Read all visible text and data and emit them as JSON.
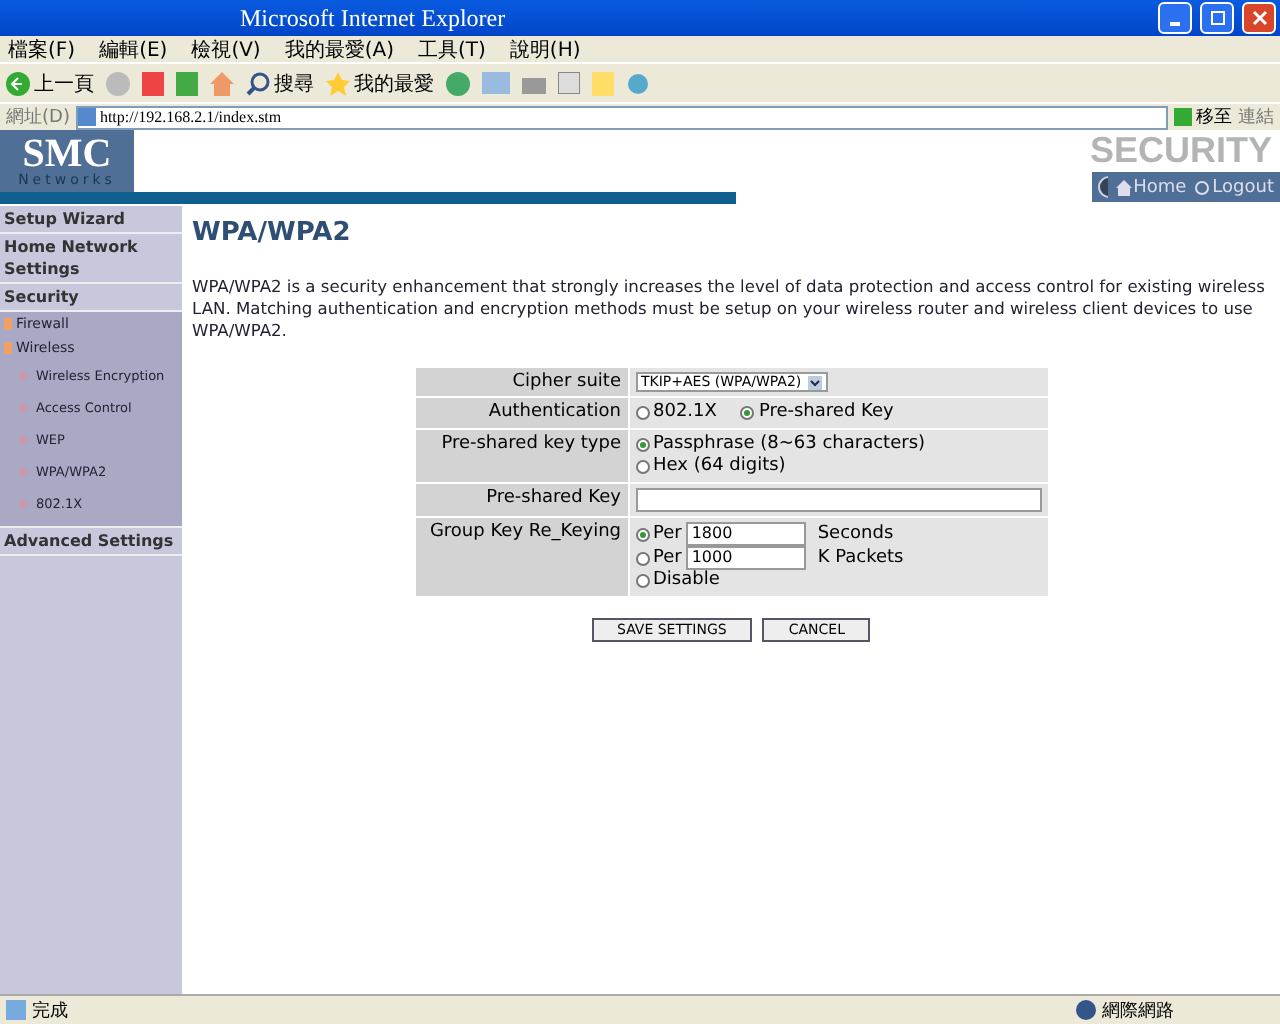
{
  "window": {
    "title": "Microsoft Internet Explorer"
  },
  "menu": [
    "檔案(F)",
    "編輯(E)",
    "檢視(V)",
    "我的最愛(A)",
    "工具(T)",
    "說明(H)"
  ],
  "toolbar": {
    "back": "上一頁",
    "search": "搜尋",
    "favorites": "我的最愛"
  },
  "address": {
    "label": "網址(D)",
    "value": "http://192.168.2.1/index.stm",
    "go": "移至",
    "links": "連結"
  },
  "header": {
    "logo": "SMC",
    "logo_sub": "Networks",
    "section": "SECURITY",
    "home": "Home",
    "logout": "Logout"
  },
  "sidebar": {
    "items": [
      {
        "label": "Setup Wizard",
        "kind": "top"
      },
      {
        "label": "Home Network Settings",
        "kind": "top"
      },
      {
        "label": "Security",
        "kind": "top",
        "children": [
          {
            "label": "Firewall",
            "kind": "sub"
          },
          {
            "label": "Wireless",
            "kind": "sub"
          },
          {
            "label": "Wireless Encryption",
            "kind": "leaf"
          },
          {
            "label": "Access Control",
            "kind": "leaf"
          },
          {
            "label": "WEP",
            "kind": "leaf"
          },
          {
            "label": "WPA/WPA2",
            "kind": "leaf"
          },
          {
            "label": "802.1X",
            "kind": "leaf"
          }
        ]
      },
      {
        "label": "Advanced Settings",
        "kind": "top"
      }
    ]
  },
  "page": {
    "title": "WPA/WPA2",
    "description": "WPA/WPA2 is a security enhancement that strongly increases the level of data protection and access control for existing wireless LAN. Matching authentication and encryption methods must be setup on your wireless router and wireless client devices to use WPA/WPA2."
  },
  "form": [
    {
      "label": "Cipher suite",
      "kind": "select",
      "value": "TKIP+AES (WPA/WPA2)"
    },
    {
      "label": "Authentication",
      "kind": "radio-inline",
      "options": [
        {
          "label": "802.1X",
          "selected": false
        },
        {
          "label": "Pre-shared Key",
          "selected": true
        }
      ]
    },
    {
      "label": "Pre-shared key type",
      "kind": "radio",
      "options": [
        {
          "label": "Passphrase (8~63 characters)",
          "selected": true
        },
        {
          "label": "Hex (64 digits)",
          "selected": false
        }
      ]
    },
    {
      "label": "Pre-shared Key",
      "kind": "text"
    },
    {
      "label": "Group Key Re_Keying",
      "kind": "radio",
      "options": [
        {
          "label": "Per",
          "value": "1800",
          "unit": "Seconds",
          "selected": true
        },
        {
          "label": "Per",
          "value": "1000",
          "unit": "K Packets",
          "selected": false
        },
        {
          "label": "Disable",
          "selected": false
        }
      ]
    }
  ],
  "buttons": [
    "SAVE SETTINGS",
    "CANCEL"
  ],
  "status_bar": {
    "text": "完成",
    "zone": "網際網路"
  }
}
